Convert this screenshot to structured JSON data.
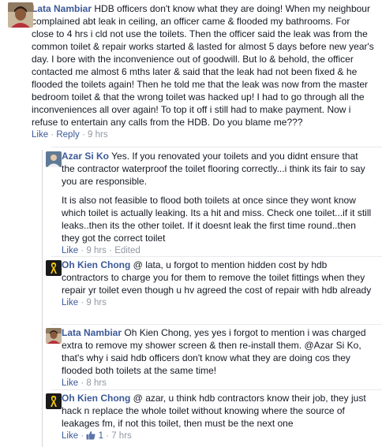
{
  "comments": [
    {
      "author": "Lata Nambiar",
      "text": "HDB officers don't know what they are doing! When my neighbour complained abt leak in ceiling, an officer came & flooded my bathrooms. For close to 4 hrs i cld not use the toilets. Then the officer said the leak was from the common toilet & repair works started & lasted for almost 5 days before new year's day. I bore with the inconvenience out of goodwill. But lo & behold, the officer contacted me almost 6 mths later & said that the leak had not been fixed & he flooded the toilets again! Then he told me that the leak was now from the master bedroom toilet & that the wrong toilet was hacked up! I had to go through all the inconveniences all over again! To top it off i still had to make payment. Now i refuse to entertain any calls from the HDB. Do you blame me???",
      "like": "Like",
      "dot1": "·",
      "reply": "Reply",
      "dot2": "·",
      "time": "9 hrs"
    }
  ],
  "replies": [
    {
      "author": "Azar Si Ko",
      "text": "Yes. If you renovated your toilets and you didnt ensure that the contractor waterproof the toilet flooring correctly...i think its fair to say you are responsible.",
      "text2": "It is also not feasible to flood both toilets at once since they wont know which toilet is actually leaking. Its a hit and miss. Check one toilet...if it still leaks..then its the other toilet. If it doesnt leak the first time round..then they got the correct toilet",
      "like": "Like",
      "dot1": "·",
      "time": "9 hrs",
      "dot2": "·",
      "edited": "Edited"
    },
    {
      "author": "Oh Kien Chong",
      "text": "@ lata, u forgot to mention hidden cost by hdb contractors to charge you for them to remove the toilet fittings when they repair yr toilet even though u hv agreed the cost of repair with hdb already",
      "like": "Like",
      "dot1": "·",
      "time": "9 hrs"
    },
    {
      "author": "Lata Nambiar",
      "text": "Oh Kien Chong, yes yes i forgot to mention i was charged extra to remove my shower screen & then re-install them. @Azar Si Ko, that's why i said hdb officers don't know what they are doing cos they flooded both toilets at the same time!",
      "like": "Like",
      "dot1": "·",
      "time": "8 hrs"
    },
    {
      "author": "Oh Kien Chong",
      "text": "@ azar, u think hdb contractors know their job, they just hack n replace the whole toilet without knowing where the source of leakages fm, if not this toilet, then must be the next one",
      "like": "Like",
      "dot1": "·",
      "likes_count": "1",
      "dot2": "·",
      "time": "7 hrs"
    }
  ],
  "colors": {
    "link": "#3b5998",
    "meta": "#9197a3",
    "text": "#141823"
  }
}
